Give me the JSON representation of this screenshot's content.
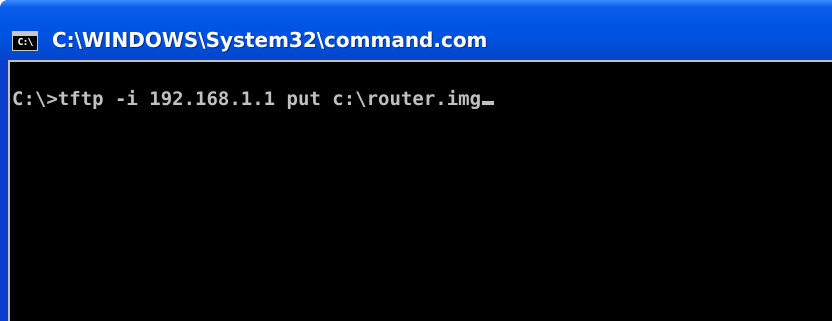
{
  "window": {
    "title": "C:\\WINDOWS\\System32\\command.com",
    "icon_name": "command-prompt-icon",
    "icon_glyph": "C:\\",
    "accent_color": "#0055e5"
  },
  "console": {
    "prompt": "C:\\>",
    "command": "tftp -i 192.168.1.1 put c:\\router.img",
    "background_color": "#000000",
    "text_color": "#c0c0c0"
  }
}
